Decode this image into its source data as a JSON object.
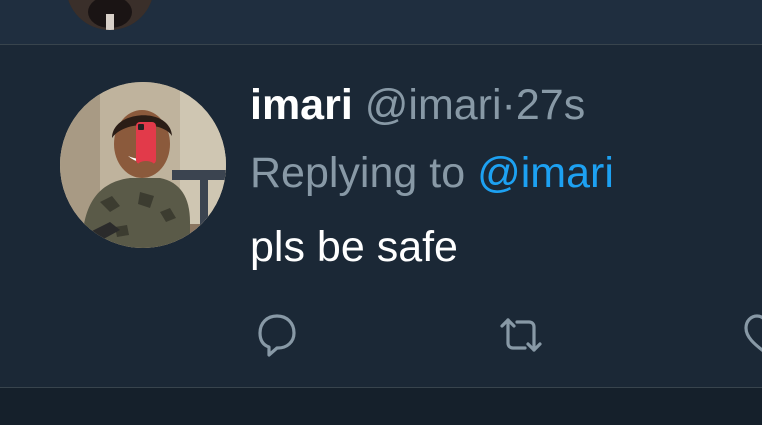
{
  "tweet": {
    "display_name": "imari",
    "handle": "@imari",
    "separator": "·",
    "timestamp": "27s",
    "replying_prefix": "Replying to",
    "replying_handle": "@imari",
    "text": "pls be safe"
  },
  "icons": {
    "reply": "reply-icon",
    "retweet": "retweet-icon",
    "like": "like-icon"
  },
  "colors": {
    "background": "#15202b",
    "tweet_background": "#1b2836",
    "secondary_text": "#8899a6",
    "link": "#1da1f2",
    "divider": "#38444d"
  }
}
